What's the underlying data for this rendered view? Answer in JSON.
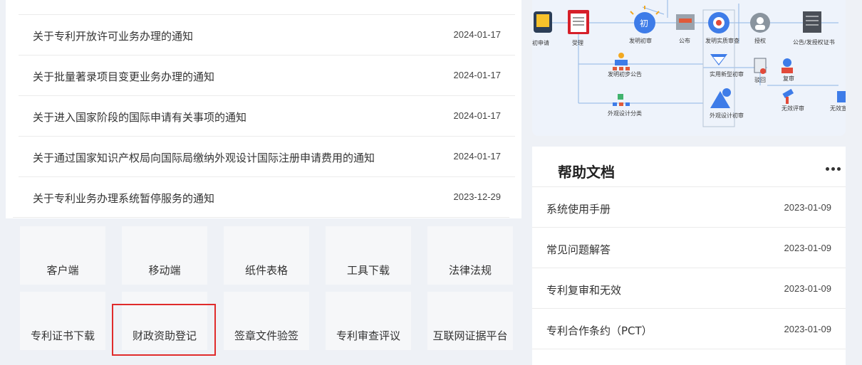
{
  "notices": [
    {
      "title": "关于专利开放许可业务办理的通知",
      "date": "2024-01-17"
    },
    {
      "title": "关于批量著录项目变更业务办理的通知",
      "date": "2024-01-17"
    },
    {
      "title": "关于进入国家阶段的国际申请有关事项的通知",
      "date": "2024-01-17"
    },
    {
      "title": "关于通过国家知识产权局向国际局缴纳外观设计国际注册申请费用的通知",
      "date": "2024-01-17"
    },
    {
      "title": "关于专利业务办理系统暂停服务的通知",
      "date": "2023-12-29"
    }
  ],
  "tiles": [
    {
      "label": "客户端"
    },
    {
      "label": "移动端"
    },
    {
      "label": "纸件表格"
    },
    {
      "label": "工具下载"
    },
    {
      "label": "法律法规"
    },
    {
      "label": "专利证书下载"
    },
    {
      "label": "财政资助登记"
    },
    {
      "label": "签章文件验签"
    },
    {
      "label": "专利审查评议"
    },
    {
      "label": "互联网证据平台"
    }
  ],
  "flow": {
    "labels": {
      "apply": "初申请",
      "accept": "受理",
      "initial_badge": "初",
      "initial_exam": "发明初审",
      "publish": "公布",
      "substantive": "发明实质审查",
      "grant": "授权",
      "announce_cert": "公告/发授权证书",
      "invention_pub": "发明初步公告",
      "utility_exam": "实用新型初审",
      "reject": "驳回",
      "review": "复审",
      "design_exam": "外观设计初审",
      "design_pub": "外观设计分类",
      "invalid_a": "无效评审",
      "invalid_b": "无效宣告"
    }
  },
  "help": {
    "title": "帮助文档",
    "items": [
      {
        "title": "系统使用手册",
        "date": "2023-01-09"
      },
      {
        "title": "常见问题解答",
        "date": "2023-01-09"
      },
      {
        "title": "专利复审和无效",
        "date": "2023-01-09"
      },
      {
        "title": "专利合作条约（PCT）",
        "date": "2023-01-09"
      }
    ]
  },
  "colors": {
    "accent_blue": "#3e7ce8",
    "highlight_red": "#e02b2b",
    "tile_bg": "#f6f7f9"
  }
}
